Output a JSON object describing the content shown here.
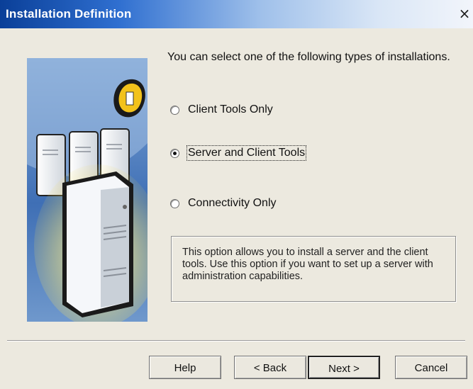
{
  "window": {
    "title": "Installation Definition",
    "close_glyph": "×"
  },
  "main": {
    "intro": "You can select one of the following types of installations.",
    "options": [
      {
        "label": "Client Tools Only",
        "selected": false
      },
      {
        "label": "Server and Client Tools",
        "selected": true
      },
      {
        "label": "Connectivity Only",
        "selected": false
      }
    ],
    "description": "This option allows you to install a server and the client tools. Use this option if you want to set up a server with administration capabilities."
  },
  "buttons": {
    "help": "Help",
    "back": "< Back",
    "next": "Next >",
    "cancel": "Cancel"
  },
  "icons": {
    "illustration": "servers-illustration-icon",
    "badge": "computer-badge-icon"
  },
  "colors": {
    "title_bar": "#0a3f98",
    "badge": "#f2c21b",
    "dialog": "#ece9df"
  }
}
